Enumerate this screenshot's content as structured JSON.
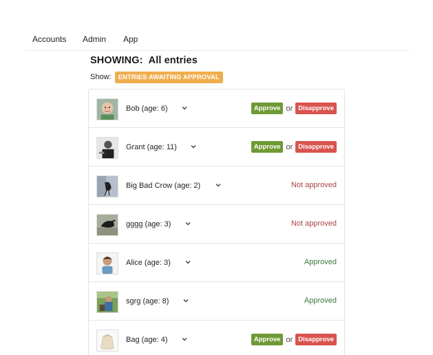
{
  "nav": {
    "items": [
      "Accounts",
      "Admin",
      "App"
    ]
  },
  "heading": {
    "label": "SHOWING:",
    "value": "All entries"
  },
  "filter": {
    "label": "Show:",
    "badge": "ENTRIES AWAITING APPROVAL"
  },
  "actions": {
    "approve": "Approve",
    "or": "or",
    "disapprove": "Disapprove"
  },
  "entries": [
    {
      "name": "Bob (age: 6)",
      "status": "pending"
    },
    {
      "name": "Grant (age: 11)",
      "status": "pending"
    },
    {
      "name": "Big Bad Crow (age: 2)",
      "status": "rejected",
      "status_text": "Not approved"
    },
    {
      "name": "gggg (age: 3)",
      "status": "rejected",
      "status_text": "Not approved"
    },
    {
      "name": "Alice (age: 3)",
      "status": "approved",
      "status_text": "Approved"
    },
    {
      "name": "sgrg (age: 8)",
      "status": "approved",
      "status_text": "Approved"
    },
    {
      "name": "Bag (age: 4)",
      "status": "pending"
    }
  ],
  "colors": {
    "approve": "#6f9a35",
    "disapprove": "#d9534f",
    "badge": "#f0ad4e",
    "not_approved": "#a94442",
    "approved": "#3c763d"
  }
}
